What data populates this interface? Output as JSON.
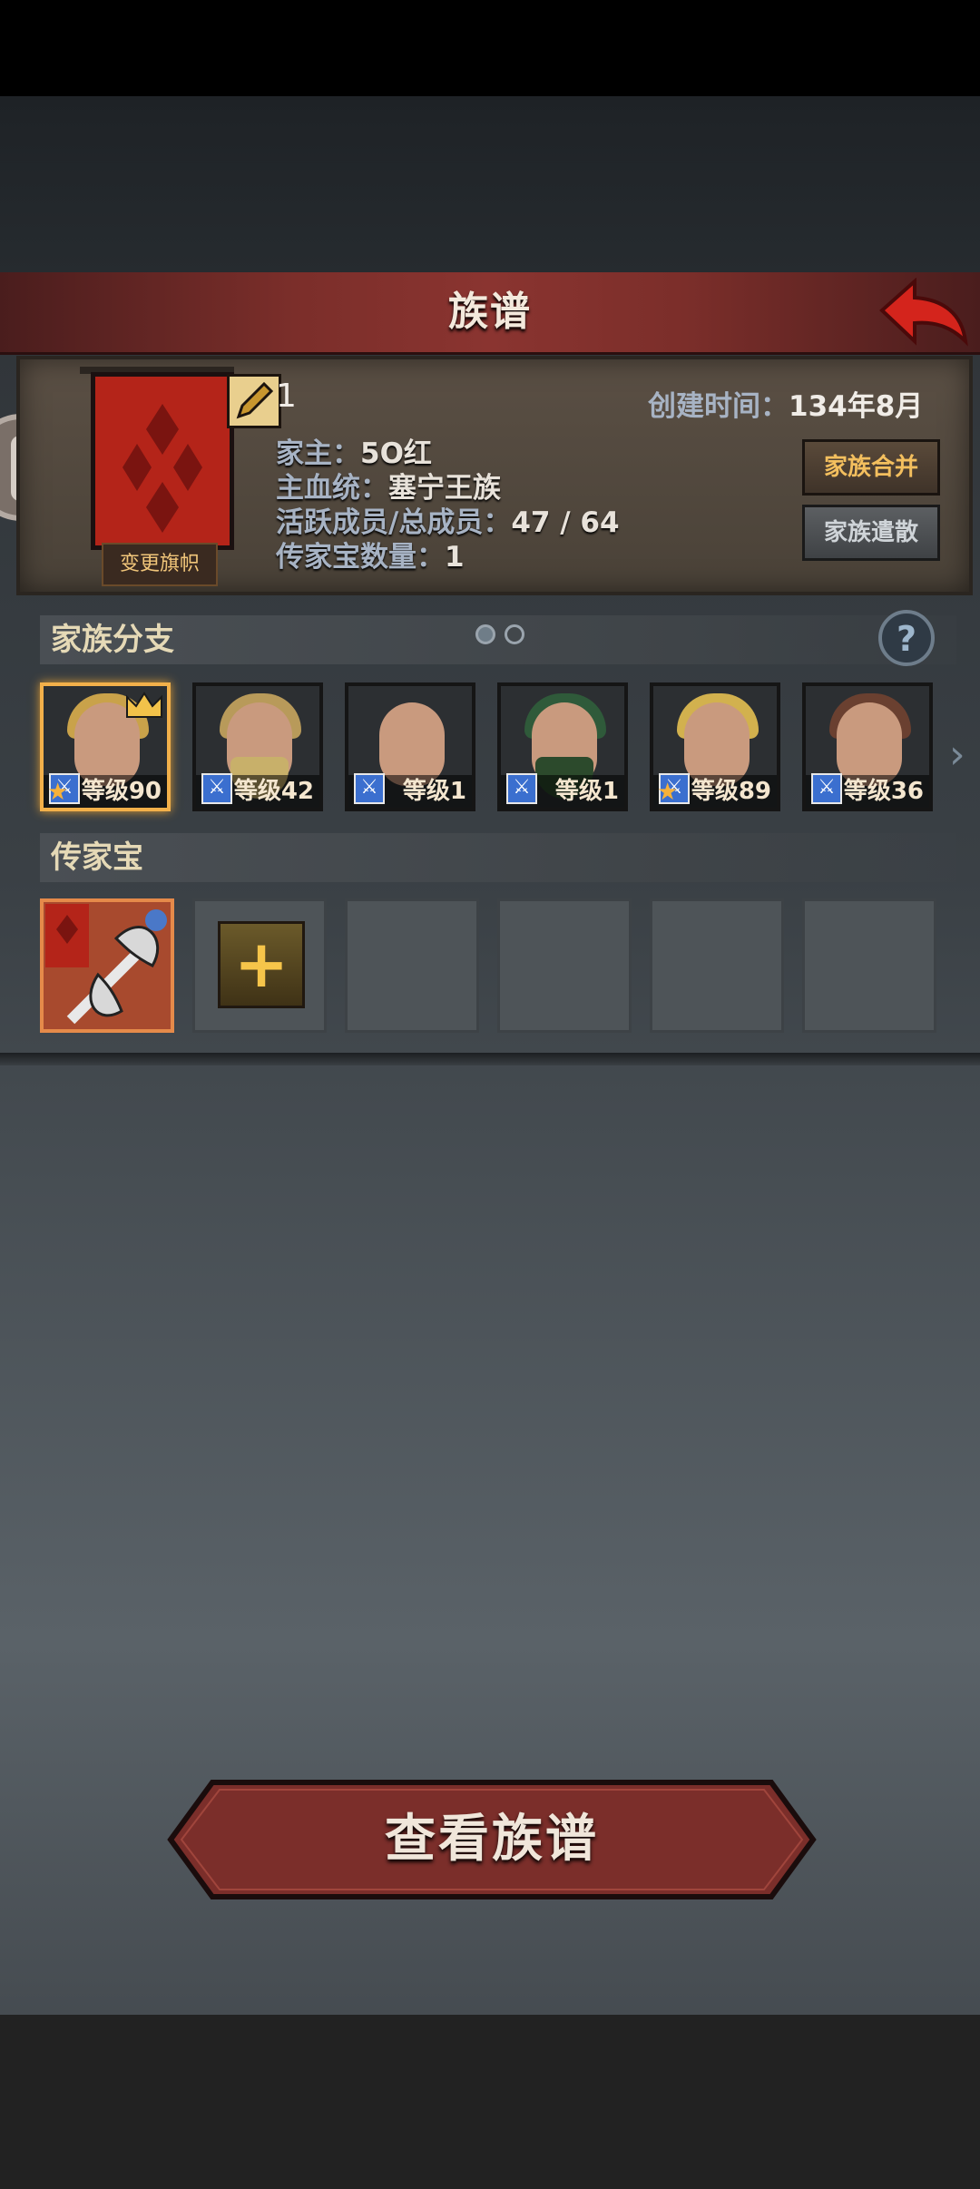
{
  "header": {
    "title": "族谱"
  },
  "family": {
    "banner_button": "变更旗帜",
    "edit_count": "1",
    "created_label": "创建时间：",
    "created_value": "134年8月",
    "lines": [
      {
        "label": "家主：",
        "value": "5O红"
      },
      {
        "label": "主血统：",
        "value": "塞宁王族"
      },
      {
        "label": "活跃成员/总成员：",
        "value": "47 / 64"
      },
      {
        "label": "传家宝数量：",
        "value": "1"
      }
    ],
    "merge_button": "家族合并",
    "dissolve_button": "家族遣散"
  },
  "branches": {
    "title": "家族分支",
    "members": [
      {
        "level": "等级90",
        "hair": "#c9a24a",
        "beard": "",
        "selected": true,
        "crown": true,
        "star": true
      },
      {
        "level": "等级42",
        "hair": "#b89a5a",
        "beard": "#c8b06a",
        "selected": false,
        "crown": false,
        "star": false
      },
      {
        "level": "等级1",
        "hair": "",
        "beard": "",
        "selected": false,
        "crown": false,
        "star": false
      },
      {
        "level": "等级1",
        "hair": "#2f5a3a",
        "beard": "#2c4a2c",
        "selected": false,
        "crown": false,
        "star": false
      },
      {
        "level": "等级89",
        "hair": "#d2b14e",
        "beard": "",
        "selected": false,
        "crown": false,
        "star": true
      },
      {
        "level": "等级36",
        "hair": "#6a4030",
        "beard": "",
        "selected": false,
        "crown": false,
        "star": false
      }
    ]
  },
  "heirlooms": {
    "title": "传家宝",
    "add_symbol": "+"
  },
  "view_button": "查看族谱",
  "colors": {
    "accent_red": "#7b2e2a",
    "gold": "#f3bf5e",
    "panel": "#4a4238"
  }
}
